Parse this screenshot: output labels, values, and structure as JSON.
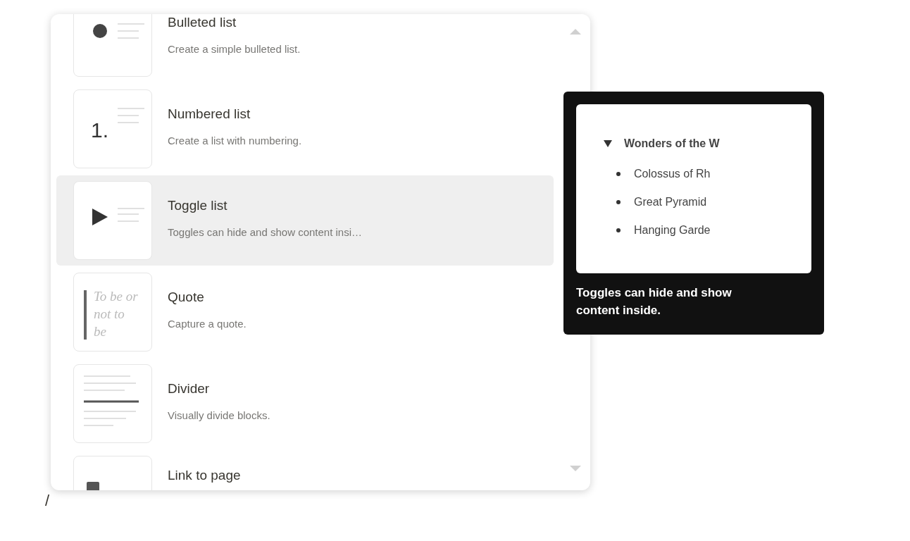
{
  "menu": {
    "items": [
      {
        "kind": "bullet",
        "title": "Bulleted list",
        "description": "Create a simple bulleted list.",
        "selected": false
      },
      {
        "kind": "number",
        "icon_text": "1.",
        "title": "Numbered list",
        "description": "Create a list with numbering.",
        "selected": false
      },
      {
        "kind": "toggle",
        "title": "Toggle list",
        "description": "Toggles can hide and show content insi…",
        "selected": true
      },
      {
        "kind": "quote",
        "icon_text": "To be or not to be",
        "title": "Quote",
        "description": "Capture a quote.",
        "selected": false
      },
      {
        "kind": "divider",
        "title": "Divider",
        "description": "Visually divide blocks.",
        "selected": false
      },
      {
        "kind": "page",
        "title": "Link to page",
        "selected": false
      }
    ]
  },
  "tooltip": {
    "preview": {
      "heading": "Wonders of the W",
      "items": [
        "Colossus of Rh",
        "Great Pyramid",
        "Hanging Garde"
      ]
    },
    "text": "Toggles can hide and show content inside."
  },
  "editor": {
    "typed_text": "/"
  }
}
